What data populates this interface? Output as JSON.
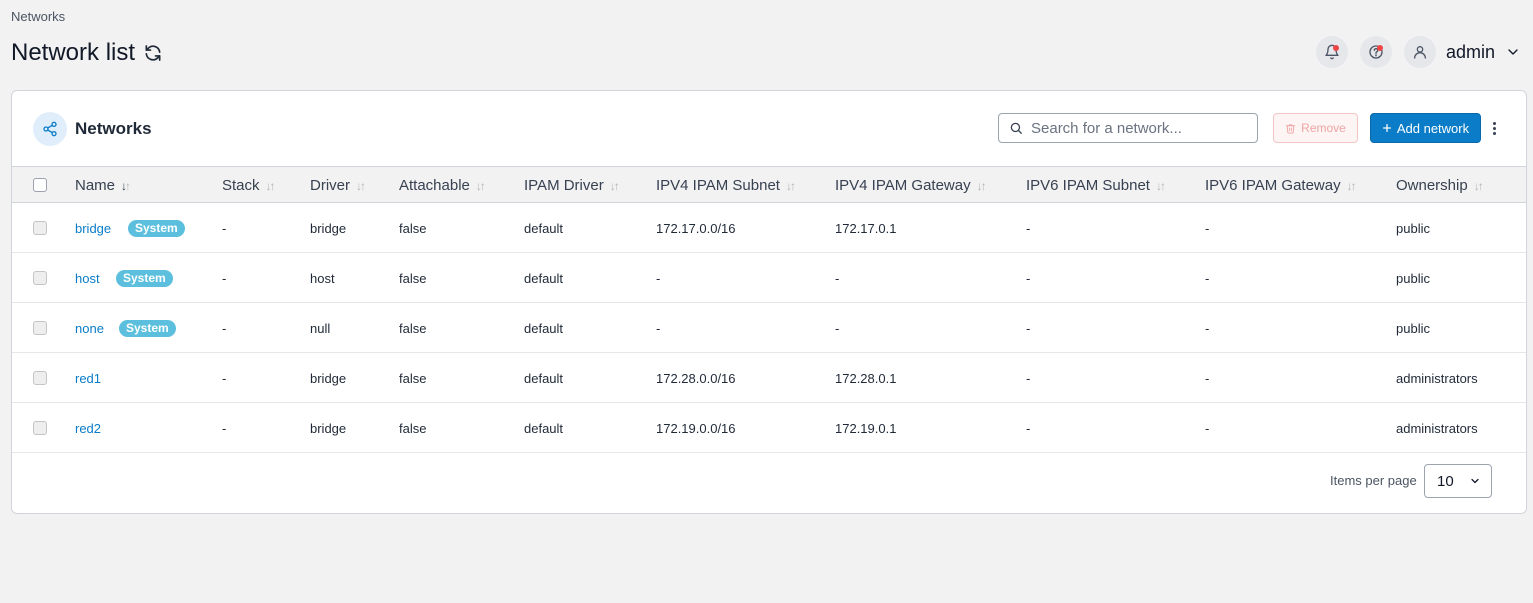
{
  "breadcrumb": "Networks",
  "page_title": "Network list",
  "user": {
    "name": "admin"
  },
  "card": {
    "title": "Networks",
    "search_placeholder": "Search for a network...",
    "remove_label": "Remove",
    "add_label": "Add network"
  },
  "columns": [
    {
      "label": "Name",
      "sorted": true
    },
    {
      "label": "Stack"
    },
    {
      "label": "Driver"
    },
    {
      "label": "Attachable"
    },
    {
      "label": "IPAM Driver"
    },
    {
      "label": "IPV4 IPAM Subnet"
    },
    {
      "label": "IPV4 IPAM Gateway"
    },
    {
      "label": "IPV6 IPAM Subnet"
    },
    {
      "label": "IPV6 IPAM Gateway"
    },
    {
      "label": "Ownership"
    }
  ],
  "rows": [
    {
      "name": "bridge",
      "badge": "System",
      "stack": "-",
      "driver": "bridge",
      "attachable": "false",
      "ipam_driver": "default",
      "ipv4_subnet": "172.17.0.0/16",
      "ipv4_gateway": "172.17.0.1",
      "ipv6_subnet": "-",
      "ipv6_gateway": "-",
      "ownership": "public"
    },
    {
      "name": "host",
      "badge": "System",
      "stack": "-",
      "driver": "host",
      "attachable": "false",
      "ipam_driver": "default",
      "ipv4_subnet": "-",
      "ipv4_gateway": "-",
      "ipv6_subnet": "-",
      "ipv6_gateway": "-",
      "ownership": "public"
    },
    {
      "name": "none",
      "badge": "System",
      "stack": "-",
      "driver": "null",
      "attachable": "false",
      "ipam_driver": "default",
      "ipv4_subnet": "-",
      "ipv4_gateway": "-",
      "ipv6_subnet": "-",
      "ipv6_gateway": "-",
      "ownership": "public"
    },
    {
      "name": "red1",
      "stack": "-",
      "driver": "bridge",
      "attachable": "false",
      "ipam_driver": "default",
      "ipv4_subnet": "172.28.0.0/16",
      "ipv4_gateway": "172.28.0.1",
      "ipv6_subnet": "-",
      "ipv6_gateway": "-",
      "ownership": "administrators"
    },
    {
      "name": "red2",
      "stack": "-",
      "driver": "bridge",
      "attachable": "false",
      "ipam_driver": "default",
      "ipv4_subnet": "172.19.0.0/16",
      "ipv4_gateway": "172.19.0.1",
      "ipv6_subnet": "-",
      "ipv6_gateway": "-",
      "ownership": "administrators"
    }
  ],
  "pagination": {
    "items_per_page_label": "Items per page",
    "items_per_page": "10"
  },
  "colors": {
    "accent": "#0a7cc8",
    "badge": "#5bbfdd",
    "notification_dot": "#ef4444"
  }
}
